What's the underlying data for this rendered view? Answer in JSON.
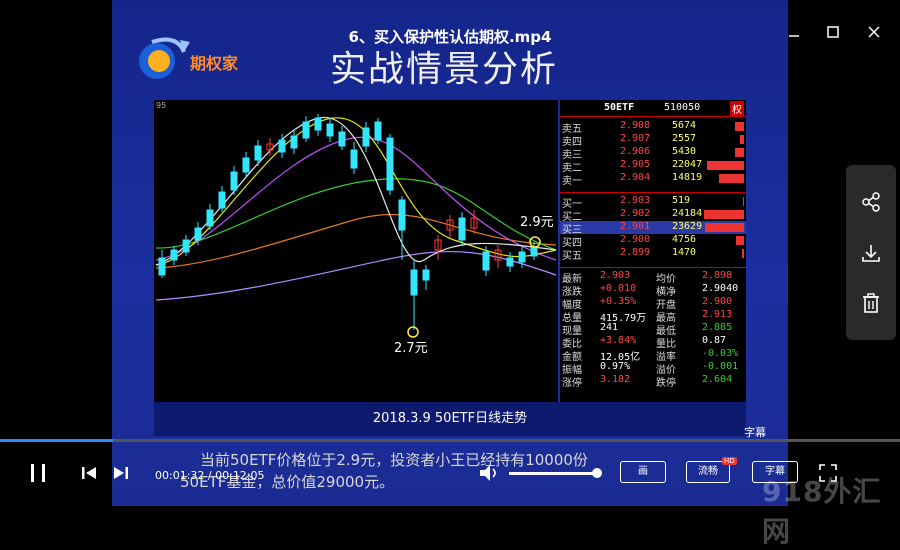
{
  "window": {
    "title": "6、买入保护性认估期权.mp4",
    "minimize_icon": "minimize-icon",
    "maximize_icon": "maximize-icon",
    "close_icon": "close-icon"
  },
  "slide": {
    "logo_text": "期权家",
    "heading": "实战情景分析",
    "chart": {
      "corner_label": "95",
      "annotation_high": "2.9元",
      "annotation_low": "2.7元",
      "caption": "2018.3.9 50ETF日线走势",
      "colors": {
        "up": "#ff3b3b",
        "down": "#33e6ff",
        "ma_white": "#e8e8e8",
        "ma_yellow": "#e6e600",
        "ma_green": "#33cc33",
        "ma_purple": "#c050ff",
        "ma_orange": "#e07a20",
        "ma_violet": "#b38cff"
      }
    },
    "quote": {
      "name": "50ETF",
      "code": "510050",
      "tag": "权",
      "asks": [
        {
          "label": "卖五",
          "price": "2.908",
          "volume": "5674"
        },
        {
          "label": "卖四",
          "price": "2.907",
          "volume": "2557"
        },
        {
          "label": "卖三",
          "price": "2.906",
          "volume": "5430"
        },
        {
          "label": "卖二",
          "price": "2.905",
          "volume": "22047"
        },
        {
          "label": "卖一",
          "price": "2.904",
          "volume": "14819"
        }
      ],
      "bids": [
        {
          "label": "买一",
          "price": "2.903",
          "volume": "519"
        },
        {
          "label": "买二",
          "price": "2.902",
          "volume": "24184"
        },
        {
          "label": "买三",
          "price": "2.901",
          "volume": "23629"
        },
        {
          "label": "买四",
          "price": "2.900",
          "volume": "4756"
        },
        {
          "label": "买五",
          "price": "2.899",
          "volume": "1470"
        }
      ],
      "stats": [
        {
          "l1": "最新",
          "v1": "2.903",
          "l2": "均价",
          "v2": "2.898",
          "c1": "#ff4444",
          "c2": "#ff4444"
        },
        {
          "l1": "涨跌",
          "v1": "+0.010",
          "l2": "横净",
          "v2": "2.9040",
          "c1": "#ff4444",
          "c2": "#ffffff"
        },
        {
          "l1": "幅度",
          "v1": "+0.35%",
          "l2": "开盘",
          "v2": "2.900",
          "c1": "#ff4444",
          "c2": "#ff4444"
        },
        {
          "l1": "总量",
          "v1": "415.79万",
          "l2": "最高",
          "v2": "2.913",
          "c1": "#ffffff",
          "c2": "#ff4444"
        },
        {
          "l1": "现量",
          "v1": "241",
          "l2": "最低",
          "v2": "2.885",
          "c1": "#ffffff",
          "c2": "#33cc33"
        },
        {
          "l1": "委比",
          "v1": "+3.84%",
          "l2": "量比",
          "v2": "0.87",
          "c1": "#ff4444",
          "c2": "#ffffff"
        },
        {
          "l1": "金额",
          "v1": "12.05亿",
          "l2": "溢率",
          "v2": "-0.03%",
          "c1": "#ffffff",
          "c2": "#33cc33"
        },
        {
          "l1": "振幅",
          "v1": "0.97%",
          "l2": "溢价",
          "v2": "-0.001",
          "c1": "#ffffff",
          "c2": "#33cc33"
        },
        {
          "l1": "涨停",
          "v1": "3.182",
          "l2": "跌停",
          "v2": "2.604",
          "c1": "#ff4444",
          "c2": "#33cc33"
        }
      ]
    },
    "subtitle_line1": "当前50ETF价格位于2.9元，投资者小王已经持有10000份",
    "subtitle_line2": "50ETF基金，总价值29000元。"
  },
  "player": {
    "progress": 0.126,
    "current_time": "00:01:32",
    "separator": " / ",
    "total_time": "00:12:05",
    "volume": 0.92,
    "buttons": {
      "pip": "画",
      "speed": "流畅",
      "speed_badge": "HD",
      "subtitles": "字幕",
      "subtitle_overlay": "字幕"
    }
  },
  "side_panel": {
    "share_icon": "share-icon",
    "download_icon": "download-icon",
    "delete_icon": "trash-icon"
  },
  "watermark": "918外汇网"
}
